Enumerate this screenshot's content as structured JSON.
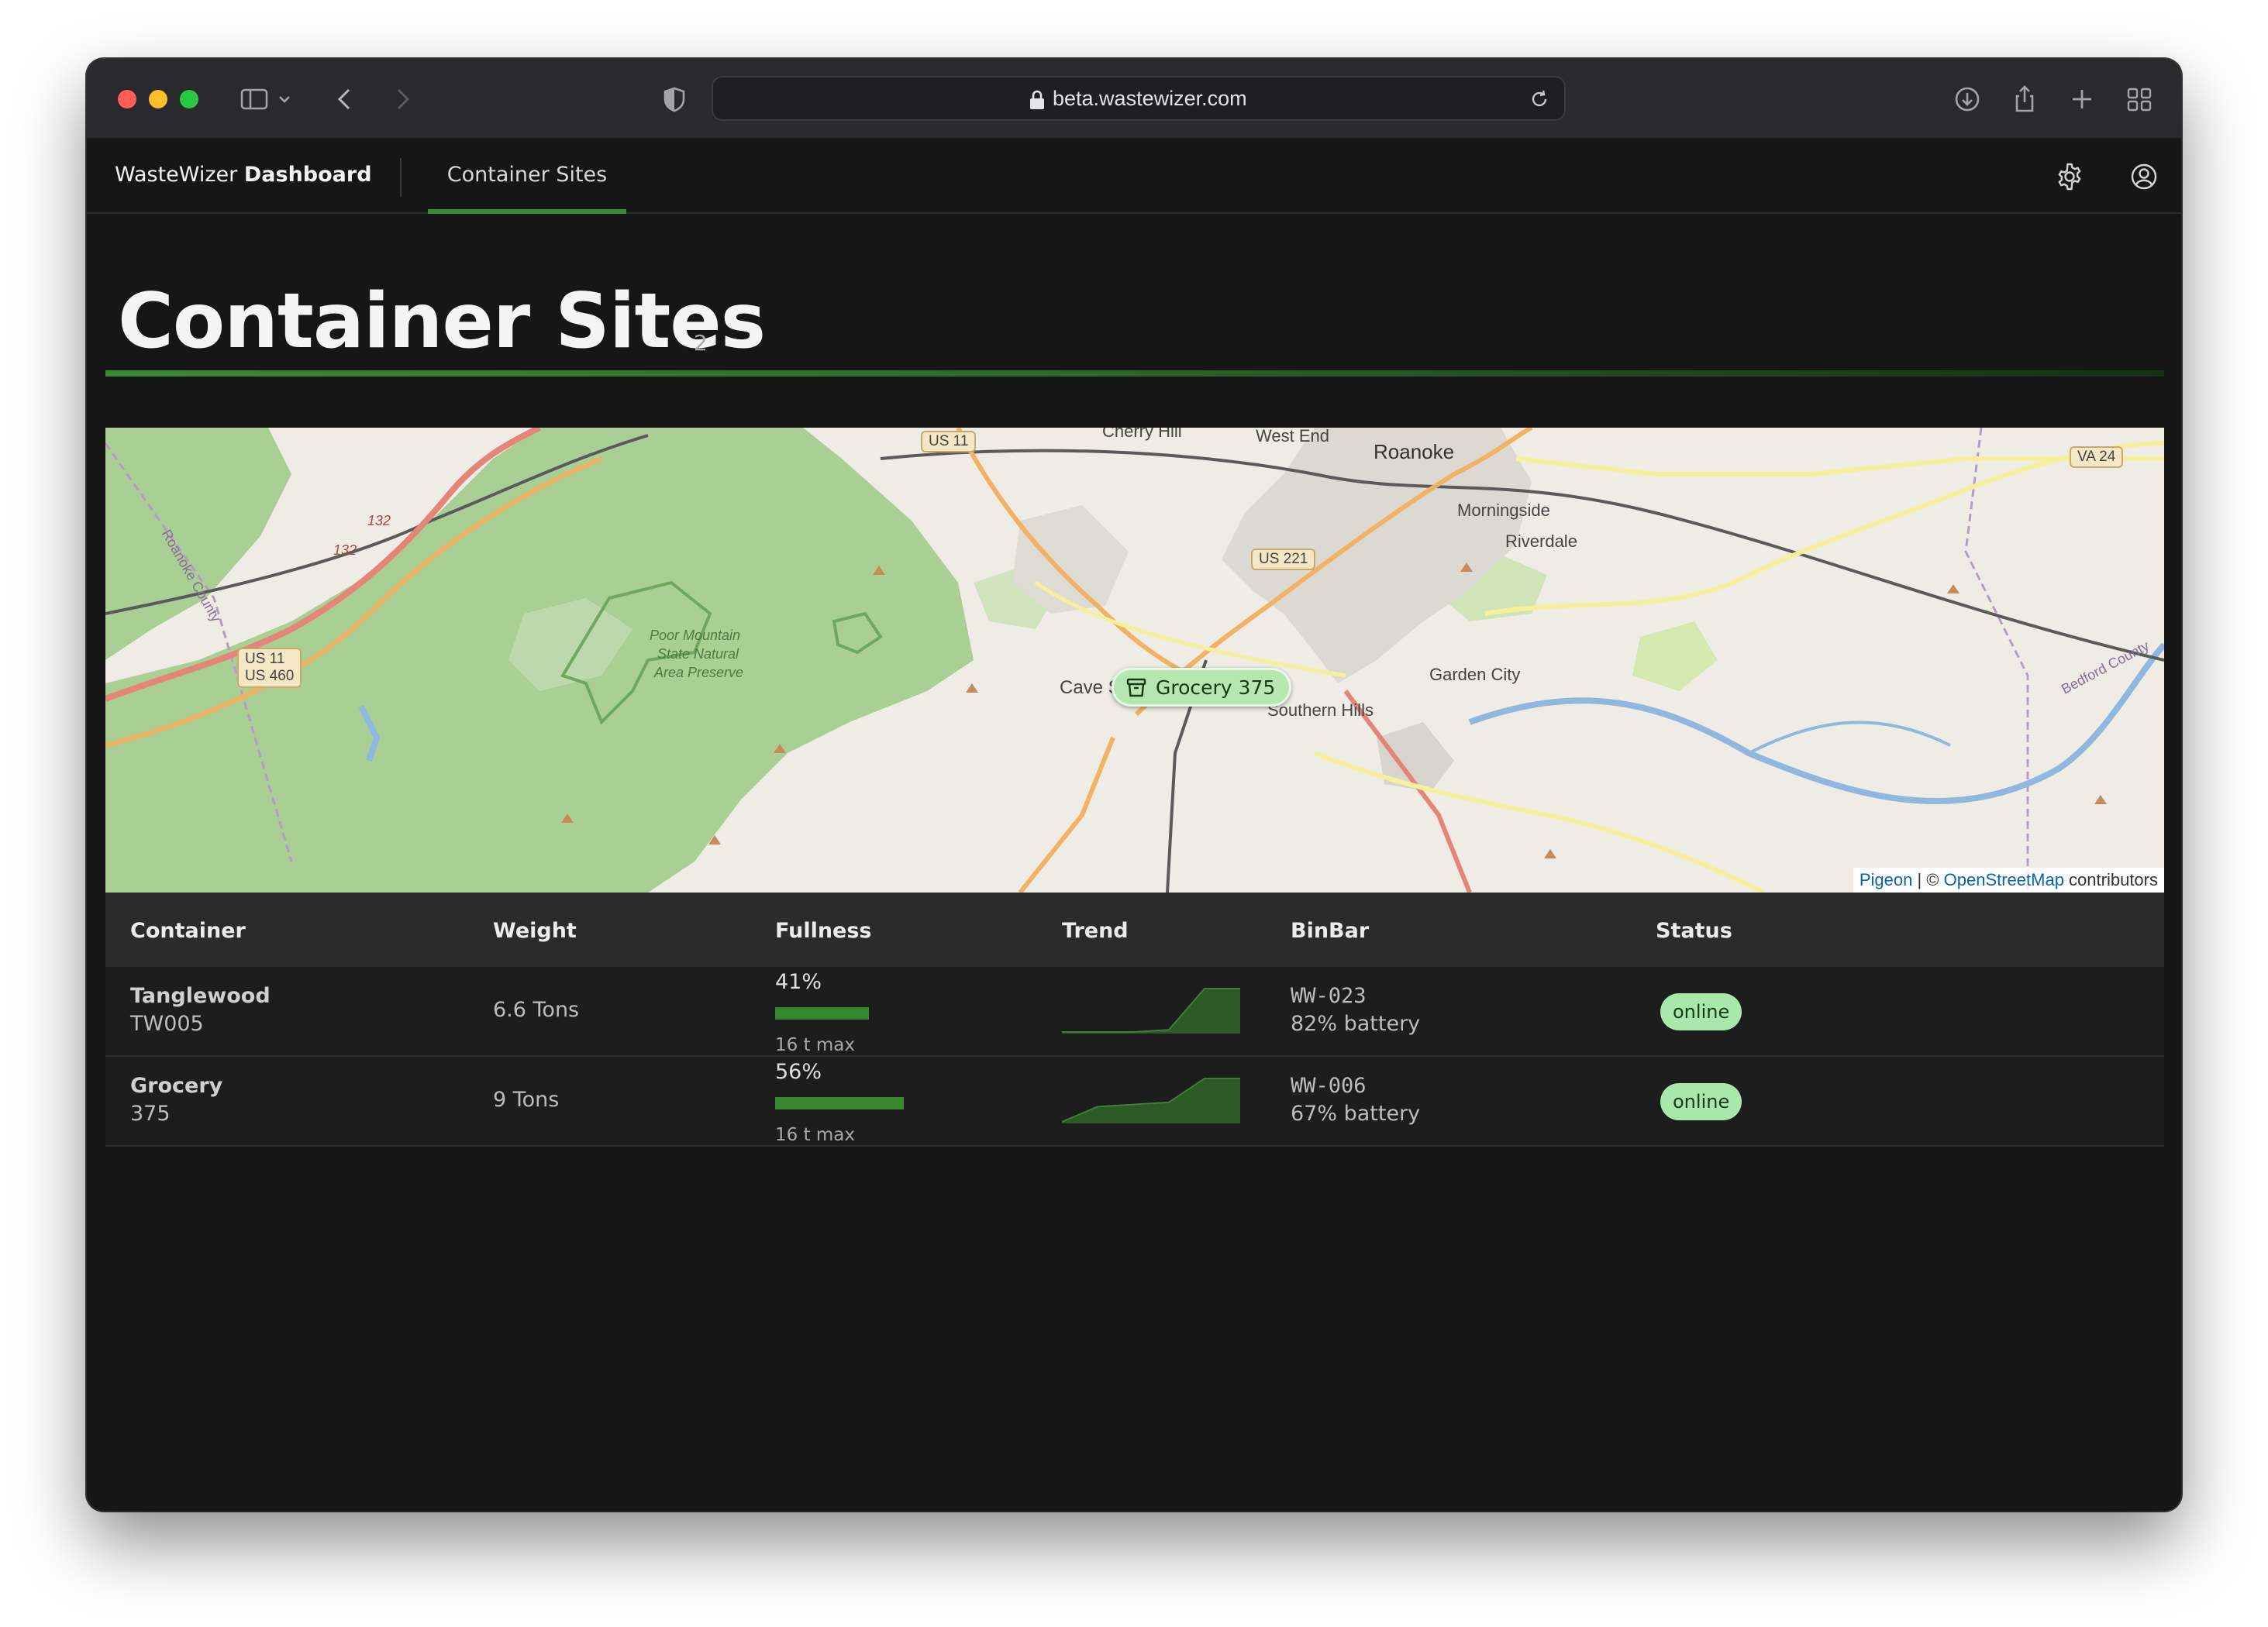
{
  "browser": {
    "url": "beta.wastewizer.com"
  },
  "nav": {
    "brand_light": "WasteWizer",
    "brand_bold": "Dashboard",
    "active_tab": "Container Sites"
  },
  "page": {
    "title": "Container Sites",
    "count": "2"
  },
  "map": {
    "marker_label": "Grocery 375",
    "labels": {
      "roanoke": "Roanoke",
      "west_end": "West End",
      "cherry_hill": "Cherry Hill",
      "morningside": "Morningside",
      "riverdale": "Riverdale",
      "cave_spring": "Cave Spring",
      "southern_hills": "Southern Hills",
      "garden_city": "Garden City",
      "poor_mountain_1": "Poor Mountain",
      "poor_mountain_2": "State Natural",
      "poor_mountain_3": "Area Preserve",
      "roanoke_county": "Roanoke County",
      "bedford_county": "Bedford County",
      "r132a": "132",
      "r132b": "132"
    },
    "shields": {
      "us11_top": "US 11",
      "us221": "US 221",
      "va24": "VA 24",
      "us11_left": "US 11",
      "us460_left": "US 460"
    },
    "attribution": {
      "pigeon": "Pigeon",
      "separator": " | © ",
      "osm": "OpenStreetMap",
      "suffix": " contributors"
    },
    "colors": {
      "forest": "#a9cf95",
      "land": "#efece6",
      "water": "#8fb7e0",
      "major_road": "#f2b264",
      "secondary_road": "#f6f09a",
      "highway": "#e5857a",
      "rail": "#555555"
    }
  },
  "table": {
    "headers": {
      "container": "Container",
      "weight": "Weight",
      "fullness": "Fullness",
      "trend": "Trend",
      "binbar": "BinBar",
      "status": "Status"
    },
    "rows": [
      {
        "name": "Tanglewood",
        "code": "TW005",
        "weight": "6.6 Tons",
        "fullness_pct": "41%",
        "fullness_value": 0.41,
        "max": "16 t max",
        "trend": [
          0,
          0,
          0,
          0.05,
          1,
          1
        ],
        "binbar_id": "WW-023",
        "battery": "82% battery",
        "status": "online"
      },
      {
        "name": "Grocery",
        "code": "375",
        "weight": "9 Tons",
        "fullness_pct": "56%",
        "fullness_value": 0.56,
        "max": "16 t max",
        "trend": [
          0,
          0.35,
          0.4,
          0.45,
          1,
          1
        ],
        "binbar_id": "WW-006",
        "battery": "67% battery",
        "status": "online"
      }
    ]
  },
  "colors": {
    "accent": "#3a8a34",
    "badge_bg": "#a9e8ab",
    "window_bg": "#161616"
  }
}
